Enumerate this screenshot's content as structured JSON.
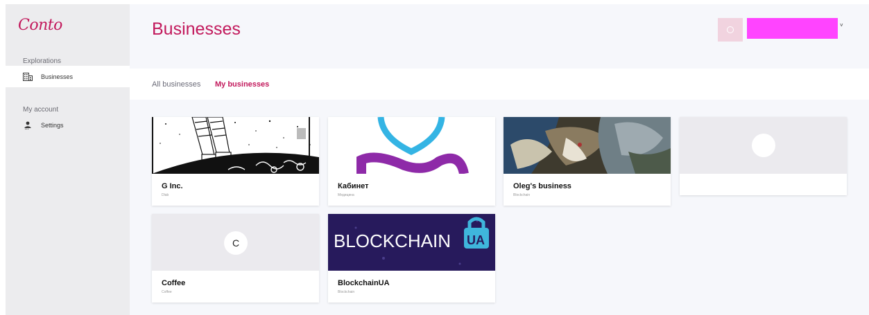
{
  "app": {
    "logo": "Conto"
  },
  "sidebar": {
    "sections": [
      {
        "title": "Explorations",
        "items": [
          {
            "label": "Businesses",
            "icon": "building-icon",
            "active": true
          }
        ]
      },
      {
        "title": "My account",
        "items": [
          {
            "label": "Settings",
            "icon": "person-icon",
            "active": false
          }
        ]
      }
    ]
  },
  "header": {
    "title": "Businesses",
    "user": {
      "avatar_icon": "avatar-ring-icon",
      "chevron": "˅",
      "name_color": "#ff44ff"
    }
  },
  "tabs": [
    {
      "label": "All businesses",
      "active": false
    },
    {
      "label": "My businesses",
      "active": true
    }
  ],
  "businesses": [
    {
      "name": "G Inc.",
      "category": "Dlab",
      "thumb": "rocket-illustration"
    },
    {
      "name": "Кабинет",
      "category": "Медицина",
      "thumb": "purple-logo"
    },
    {
      "name": "Oleg's business",
      "category": "Blockchain",
      "thumb": "painting"
    },
    {
      "name": "",
      "category": "",
      "thumb": "placeholder-circle"
    },
    {
      "name": "Coffee",
      "category": "Coffee",
      "thumb": "letter",
      "letter": "C"
    },
    {
      "name": "BlockchainUA",
      "category": "Blockchain",
      "thumb": "blockchain-banner",
      "banner_text": "BLOCKCHAIN",
      "banner_badge": "UA"
    }
  ],
  "colors": {
    "accent": "#c2185b",
    "sidebar_bg": "#ececee",
    "main_bg": "#f6f7fb"
  }
}
